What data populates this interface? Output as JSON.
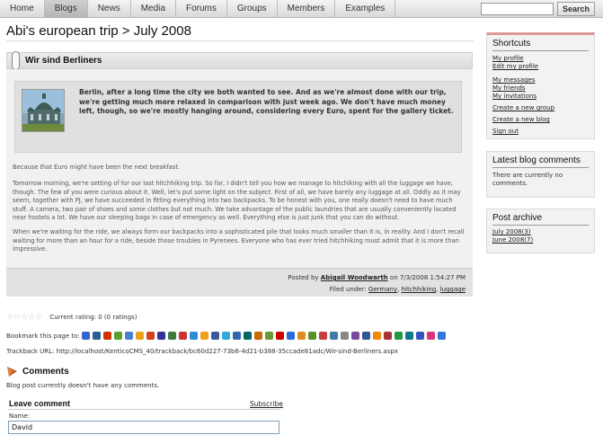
{
  "nav": {
    "tabs": [
      "Home",
      "Blogs",
      "News",
      "Media",
      "Forums",
      "Groups",
      "Members",
      "Examples"
    ],
    "active_tab": "Blogs",
    "search_button": "Search",
    "search_value": ""
  },
  "page": {
    "title": "Abi's european trip > July 2008"
  },
  "post": {
    "title": "Wir sind Berliners",
    "summary": "Berlin, after a long time the city we both wanted to see. And as we're almost done with our trip, we're getting much more relaxed in comparison with just week ago. We don't have much money left, though, so we're mostly hanging around, considering every Euro, spent for the gallery ticket.",
    "paragraphs": [
      "Because that Euro might have been the next breakfast.",
      "Tomorrow morning, we're setting of for our last hitchhiking trip. So far, I didn't tell you how we manage to hitchiking with all the luggage we have, though. The few of you were curious about it. Well, let's put some light on the subject. First of all, we have barely any luggage at all. Oddly as it may seem, together with PJ, we have succeeded in fitting everything into two backpacks. To be honest with you, one really doesn't need to have much stuff. A camera, two pair of shoes and some clothes but not much. We take advantage of the public laundries that are usually conveniently located near hostels a lot. We have our sleeping bags in case of emergency as well. Everything else is just junk that you can do without.",
      "When we're waiting for the ride, we always form our backpacks into a sophisticated pile that looks much smaller than it is, in reality. And I don't recall waiting for more than an hour for a ride, beside those troubles in Pyrenees. Everyone who has ever tried hitchhiking must admit that it is more than impressive."
    ],
    "posted_by_prefix": "Posted by",
    "author": "Abigail Woodwarth",
    "posted_on": "on 7/3/2008 1:54:27 PM",
    "filed_under_label": "Filed under:",
    "tags": [
      "Germany",
      "hitchhiking",
      "luggage"
    ]
  },
  "rating": {
    "text": "Current rating: 0 (0 ratings)",
    "value": 0,
    "max": 5
  },
  "bookmark": {
    "label": "Bookmark this page to:",
    "icons": [
      {
        "name": "delicious-icon",
        "color": "#3366cc"
      },
      {
        "name": "digg-icon",
        "color": "#2a5e95"
      },
      {
        "name": "reddit-icon",
        "color": "#cc3300"
      },
      {
        "name": "technorati-icon",
        "color": "#5aa02c"
      },
      {
        "name": "google-bookmarks-icon",
        "color": "#4a7fd6"
      },
      {
        "name": "yahoo-icon",
        "color": "#e8a317"
      },
      {
        "name": "live-icon",
        "color": "#d0421b"
      },
      {
        "name": "stumbleupon-icon",
        "color": "#333399"
      },
      {
        "name": "newsvine-icon",
        "color": "#3a7a3a"
      },
      {
        "name": "furl-icon",
        "color": "#cc3333"
      },
      {
        "name": "magnolia-icon",
        "color": "#2e8bd6"
      },
      {
        "name": "blinklist-icon",
        "color": "#f0a020"
      },
      {
        "name": "facebook-icon",
        "color": "#3b5998"
      },
      {
        "name": "twitter-icon",
        "color": "#33aadd"
      },
      {
        "name": "myspace-icon",
        "color": "#3366aa"
      },
      {
        "name": "slashdot-icon",
        "color": "#006666"
      },
      {
        "name": "propeller-icon",
        "color": "#cc6600"
      },
      {
        "name": "fark-icon",
        "color": "#669933"
      },
      {
        "name": "ask-icon",
        "color": "#cc0000"
      },
      {
        "name": "diigo-icon",
        "color": "#2b6ad6"
      },
      {
        "name": "mixx-icon",
        "color": "#e08c1a"
      },
      {
        "name": "netvouz-icon",
        "color": "#5a8f2a"
      },
      {
        "name": "simpy-icon",
        "color": "#c24040"
      },
      {
        "name": "spurl-icon",
        "color": "#4477aa"
      },
      {
        "name": "backflip-icon",
        "color": "#888888"
      },
      {
        "name": "blogmarks-icon",
        "color": "#7a4a9a"
      },
      {
        "name": "connotea-icon",
        "color": "#335599"
      },
      {
        "name": "dzone-icon",
        "color": "#ee8800"
      },
      {
        "name": "feedmelinks-icon",
        "color": "#aa3333"
      },
      {
        "name": "linkagogo-icon",
        "color": "#229944"
      },
      {
        "name": "netscape-icon",
        "color": "#117788"
      },
      {
        "name": "segnalo-icon",
        "color": "#3355bb"
      },
      {
        "name": "yahoo-myweb-icon",
        "color": "#dd3377"
      },
      {
        "name": "google-icon",
        "color": "#3377dd"
      }
    ]
  },
  "trackback": {
    "text": "Trackback URL: http://localhost/KenticoCMS_40/trackback/bc60d227-73b6-4d21-b388-35ccade81adc/Wir-sind-Berliners.aspx"
  },
  "comments": {
    "title": "Comments",
    "empty_text": "Blog post currently doesn't have any comments.",
    "leave_title": "Leave comment",
    "subscribe_label": "Subscribe",
    "name_label": "Name:",
    "name_value": "David"
  },
  "sidebar": {
    "shortcuts_title": "Shortcuts",
    "shortcut_links": [
      "My profile",
      "Edit my profile",
      "My messages",
      "My friends",
      "My invitations",
      "Create a new group",
      "Create a new blog",
      "Sign out"
    ],
    "latest_title": "Latest blog comments",
    "latest_text": "There are currently no comments.",
    "archive_title": "Post archive",
    "archive_links": [
      "July 2008(3)",
      "June 2008(7)"
    ],
    "accent_color": "#d99a9a"
  }
}
